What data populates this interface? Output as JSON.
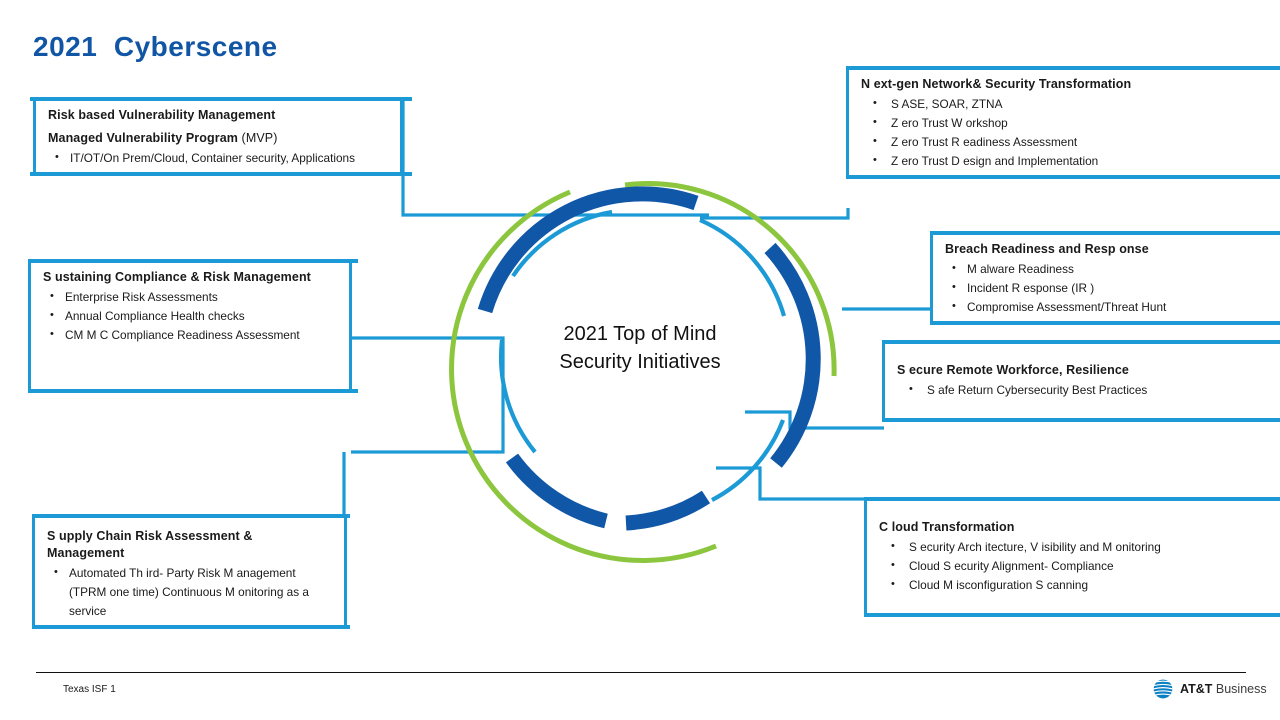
{
  "slide": {
    "title": "2021  Cyberscene",
    "title_color": "#1156A5",
    "center_line1": "2021 Top of Mind",
    "center_line2": "Security Initiatives"
  },
  "colors": {
    "ring_dark_blue": "#1157A8",
    "ring_light_blue": "#1C9AD6",
    "ring_green": "#8CC63E",
    "connector_blue": "#1C9AD6",
    "box_border": "#1C9AD6"
  },
  "boxes": [
    {
      "id": "rbvm",
      "heading": "Risk based Vulnerability Management",
      "subheading_bold": "Managed Vulnerability Program",
      "subheading_regular": " (MVP)",
      "bullets": [
        "IT/OT/On Prem/Cloud, Container security, Applications"
      ]
    },
    {
      "id": "nextgen",
      "heading": "N ext-gen Network&  Security Transformation",
      "bullets": [
        "S ASE, SOAR, ZTNA",
        "Z ero Trust W orkshop",
        "Z ero Trust R eadiness Assessment",
        "Z ero Trust D esign and Implementation"
      ]
    },
    {
      "id": "sustaining",
      "heading": "S ustaining Compliance &  Risk Management",
      "bullets": [
        "Enterprise Risk Assessments",
        "Annual Compliance Health checks",
        "CM M C Compliance Readiness Assessment"
      ]
    },
    {
      "id": "breach",
      "heading": "Breach Readiness and Resp onse",
      "bullets": [
        "M alware Readiness",
        "Incident R esponse (IR )",
        "Compromise Assessment/Threat Hunt"
      ]
    },
    {
      "id": "secure",
      "heading": "S ecure Remote Workforce, Resilience",
      "bullets": [
        "S afe Return Cybersecurity Best Practices"
      ]
    },
    {
      "id": "supply",
      "heading": "S upply Chain Risk Assessment & Management",
      "bullets": [
        "Automated Th ird- Party Risk M anagement (TPRM one time) Continuous M onitoring as a service"
      ]
    },
    {
      "id": "cloud",
      "heading": "C loud Transformation",
      "bullets": [
        "S ecurity Arch itecture, V isibility and M onitoring",
        "Cloud S ecurity Alignment- Compliance",
        "Cloud M isconfiguration S canning"
      ]
    }
  ],
  "footer": {
    "note": "Texas ISF 1",
    "logo_brand": "AT&T",
    "logo_suffix": " Business"
  },
  "bullet_glyph": "•"
}
